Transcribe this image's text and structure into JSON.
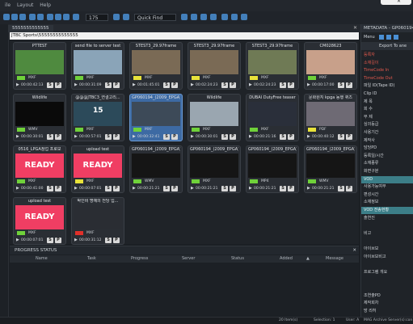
{
  "menu": {
    "items": [
      "ile",
      "Layout",
      "Help"
    ]
  },
  "window": {
    "close_glyph": "✕"
  },
  "toolbar": {
    "zoom": "175",
    "filter": "Quick Find"
  },
  "tabs": {
    "active_label": "5555555555555",
    "close": "✕"
  },
  "path": {
    "text": "JTBC Sports\\55555555555555"
  },
  "cards": [
    {
      "title": "PTTEST",
      "fmt_color": "#6fd13a",
      "fmt": "MXF",
      "tc": "00:00:42:13",
      "thumb": "#4f8a3f",
      "type": "image"
    },
    {
      "title": "send file to server test",
      "fmt_color": "#6fd13a",
      "fmt": "MXF",
      "tc": "00:00:31:09",
      "thumb": "#8aa4b8",
      "type": "image"
    },
    {
      "title": "STEST3_29.97frame",
      "fmt_color": "#e8e23a",
      "fmt": "MXF",
      "tc": "00:01:45:01",
      "thumb": "#7a6a55",
      "type": "image"
    },
    {
      "title": "STEST3_29.97frame",
      "fmt_color": "#e8e23a",
      "fmt": "MXF",
      "tc": "00:02:24:23",
      "thumb": "#7a6a55",
      "type": "image"
    },
    {
      "title": "STEST3_29.97frame",
      "fmt_color": "#e8e23a",
      "fmt": "MXF",
      "tc": "00:02:24:23",
      "thumb": "#6f7a55",
      "type": "image"
    },
    {
      "title": "CM028623",
      "fmt_color": "#6fd13a",
      "fmt": "MXF",
      "tc": "00:00:17:00",
      "thumb": "#c8a08a",
      "type": "image"
    },
    {
      "title": "Wildlife",
      "fmt_color": "#6fd13a",
      "fmt": "WMV",
      "tc": "00:00:30:01",
      "thumb": "#0a0a0a",
      "type": "image"
    },
    {
      "title": "@@@JTBC3_연결고리...",
      "fmt_color": "#6fd13a",
      "fmt": "MXF",
      "tc": "00:00:57:01",
      "thumb": "#2c4a5a",
      "type": "image",
      "overlay": "15"
    },
    {
      "title": "GP060194_(2009_EPGA)...",
      "fmt_color": "#6fd13a",
      "fmt": "MXF",
      "tc": "00:00:32:41",
      "thumb": "#3d4a58",
      "type": "image",
      "selected": true
    },
    {
      "title": "Wildlife",
      "fmt_color": "#6fd13a",
      "fmt": "MXF",
      "tc": "00:00:30:01",
      "thumb": "#9aa6b0",
      "type": "image"
    },
    {
      "title": "DUBAI DutyFree teaser",
      "fmt_color": "#6fd13a",
      "fmt": "MXF",
      "tc": "00:00:21:16",
      "thumb": "#2a2f3a",
      "type": "image"
    },
    {
      "title": "문화원지 kpga 동행 퀴즈",
      "fmt_color": "#e8e23a",
      "fmt": "PDF",
      "tc": "00:00:40:12",
      "thumb": "#6e6a74",
      "type": "image"
    },
    {
      "title": "0516_LPGA참업 프로모",
      "fmt_color": "#6fd13a",
      "fmt": "MXF",
      "tc": "00:00:41:00",
      "type": "ready",
      "ready": "READY"
    },
    {
      "title": "upload test",
      "fmt_color": "#e8e23a",
      "fmt": "MXF",
      "tc": "00:00:07:01",
      "type": "ready",
      "ready": "READY"
    },
    {
      "title": "GP060194_(2009_EPGA)...",
      "fmt_color": "#6fd13a",
      "fmt": "WMV",
      "tc": "00:00:21:21",
      "thumb": "#151515",
      "type": "image"
    },
    {
      "title": "GP060194_(2009_EPGA)...",
      "fmt_color": "#6fd13a",
      "fmt": "MXF",
      "tc": "00:00:21:21",
      "thumb": "#151515",
      "type": "image"
    },
    {
      "title": "GP060194_(2009_EPGA)...",
      "fmt_color": "#6fd13a",
      "fmt": "MP4",
      "tc": "00:00:21:21",
      "thumb": "#151515",
      "type": "image"
    },
    {
      "title": "GP060194_(2009_EPGA)...",
      "fmt_color": "#6fd13a",
      "fmt": "WMV",
      "tc": "00:00:21:21",
      "thumb": "#151515",
      "type": "image"
    },
    {
      "title": "upload test",
      "fmt_color": "#6fd13a",
      "fmt": "MXF",
      "tc": "00:00:07:01",
      "type": "ready",
      "ready": "READY"
    },
    {
      "title": "박인비 명예의 전당 입...",
      "fmt_color": "#e0302a",
      "fmt": "MXF",
      "tc": "00:00:31:12",
      "thumb": "#2a2d33",
      "type": "image"
    }
  ],
  "progress": {
    "title": "PROGRESS STATUS",
    "close": "✕",
    "columns": [
      "Name",
      "Task",
      "Progress",
      "Server",
      "Status",
      "Added",
      "▲",
      "Message"
    ]
  },
  "metadata": {
    "title": "METADATA - GP060194",
    "menu_label": "Menu",
    "export_label": "Export To ane",
    "rows": [
      {
        "label": "등록자",
        "style": "red"
      },
      {
        "label": "소재길이",
        "style": "red"
      },
      {
        "label": "TimeCode In",
        "style": "red"
      },
      {
        "label": "TimeCode Out",
        "style": "red"
      },
      {
        "label": "파일 ID(Tape ID)",
        "style": "white"
      },
      {
        "label": "Clip ID",
        "style": "white"
      },
      {
        "label": "제 목",
        "style": "white"
      },
      {
        "label": "회 수",
        "style": "white"
      },
      {
        "label": "부 제",
        "style": "white"
      },
      {
        "label": "심의등급",
        "style": "white"
      },
      {
        "label": "사용기간",
        "style": "white"
      },
      {
        "label": "제작사",
        "style": "white"
      },
      {
        "label": "담당PD",
        "style": "white"
      },
      {
        "label": "등록일/시간",
        "style": "white"
      },
      {
        "label": "소재종류",
        "style": "white"
      },
      {
        "label": "화면구분",
        "style": "white"
      },
      {
        "label": "VOD",
        "style": "hl"
      },
      {
        "label": "사용가능여부",
        "style": "white"
      },
      {
        "label": "편성시간",
        "style": "white"
      },
      {
        "label": "소재정보",
        "style": "white"
      },
      {
        "label": "VOD 전송현황",
        "style": "hl"
      },
      {
        "label": "출연진",
        "style": "white"
      },
      {
        "label": "",
        "style": "white"
      },
      {
        "label": "비고",
        "style": "white"
      },
      {
        "label": "",
        "style": "white"
      },
      {
        "label": "아이브보",
        "style": "white"
      },
      {
        "label": "아이브보비고",
        "style": "white"
      },
      {
        "label": "",
        "style": "white"
      },
      {
        "label": "프로그램 개요",
        "style": "white"
      },
      {
        "label": "",
        "style": "white"
      },
      {
        "label": "",
        "style": "white"
      },
      {
        "label": "조연출PD",
        "style": "white"
      },
      {
        "label": "제작회차",
        "style": "white"
      },
      {
        "label": "방 리허",
        "style": "white"
      }
    ]
  },
  "status": {
    "items": "20 Item(s)",
    "selection": "Selection: 1",
    "user": "User: A",
    "server": "MAG Archive Server(s):conn"
  }
}
